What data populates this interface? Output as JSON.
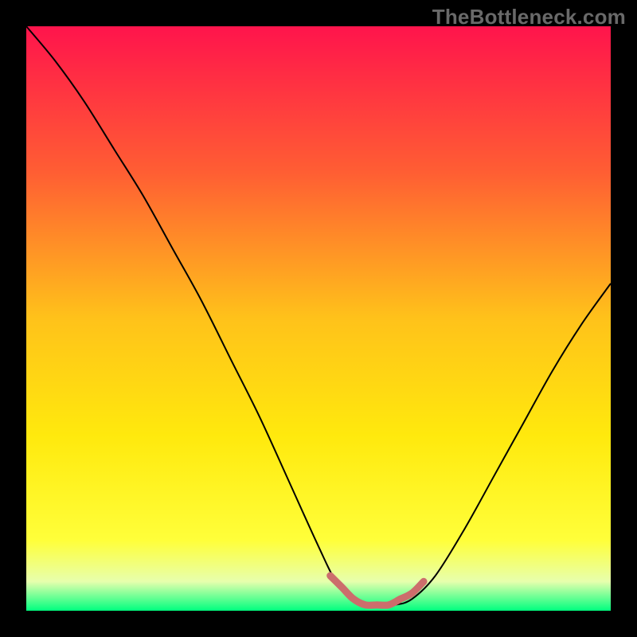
{
  "watermark": "TheBottleneck.com",
  "chart_data": {
    "type": "line",
    "title": "",
    "xlabel": "",
    "ylabel": "",
    "xlim": [
      0,
      100
    ],
    "ylim": [
      0,
      100
    ],
    "grid": false,
    "legend": false,
    "background_gradient": {
      "direction": "vertical",
      "stops": [
        {
          "pos": 0.0,
          "color": "#ff144c"
        },
        {
          "pos": 0.25,
          "color": "#ff5e33"
        },
        {
          "pos": 0.5,
          "color": "#ffc21a"
        },
        {
          "pos": 0.7,
          "color": "#ffe90d"
        },
        {
          "pos": 0.88,
          "color": "#ffff3a"
        },
        {
          "pos": 0.95,
          "color": "#e7ffad"
        },
        {
          "pos": 1.0,
          "color": "#00ff7f"
        }
      ]
    },
    "series": [
      {
        "name": "bottleneck-curve",
        "color": "#000000",
        "stroke_width": 2,
        "x": [
          0,
          5,
          10,
          15,
          20,
          25,
          30,
          35,
          40,
          45,
          50,
          53,
          56,
          60,
          63,
          66,
          70,
          75,
          80,
          85,
          90,
          95,
          100
        ],
        "y": [
          100,
          94,
          87,
          79,
          71,
          62,
          53,
          43,
          33,
          22,
          11,
          5,
          2,
          1,
          1,
          2,
          6,
          14,
          23,
          32,
          41,
          49,
          56
        ]
      },
      {
        "name": "optimal-range-marker",
        "color": "#cc6d6c",
        "stroke_width": 9,
        "x": [
          52,
          54,
          56,
          58,
          60,
          62,
          64,
          66,
          68
        ],
        "y": [
          6,
          4,
          2,
          1,
          1,
          1,
          2,
          3,
          5
        ]
      }
    ]
  }
}
